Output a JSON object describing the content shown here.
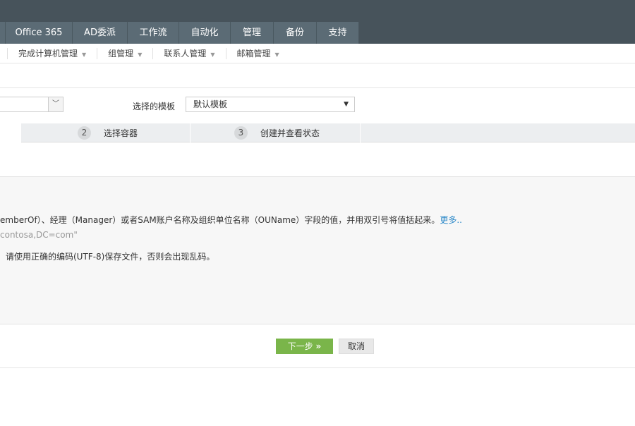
{
  "nav": {
    "tabs": [
      "Office 365",
      "AD委派",
      "工作流",
      "自动化",
      "管理",
      "备份",
      "支持"
    ]
  },
  "subnav": {
    "items": [
      "完成计算机管理",
      "组管理",
      "联系人管理",
      "邮箱管理"
    ]
  },
  "form": {
    "template_label": "选择的模板",
    "template_value": "默认模板"
  },
  "steps": [
    {
      "num": "2",
      "label": "选择容器"
    },
    {
      "num": "3",
      "label": "创建并查看状态"
    }
  ],
  "info": {
    "line1": "emberOf）、经理（Manager）或者SAM账户名称及组织单位名称（OUName）字段的值，并用双引号将值括起来。",
    "more": "更多..",
    "line2": "contosa,DC=com\"",
    "line3": "请使用正确的编码(UTF-8)保存文件，否则会出现乱码。"
  },
  "buttons": {
    "next": "下一步",
    "next_icon": "»",
    "cancel": "取消"
  },
  "colors": {
    "header": "#47535b",
    "tab": "#5b6b75",
    "primary": "#7ab54a",
    "link": "#2a87c8"
  }
}
